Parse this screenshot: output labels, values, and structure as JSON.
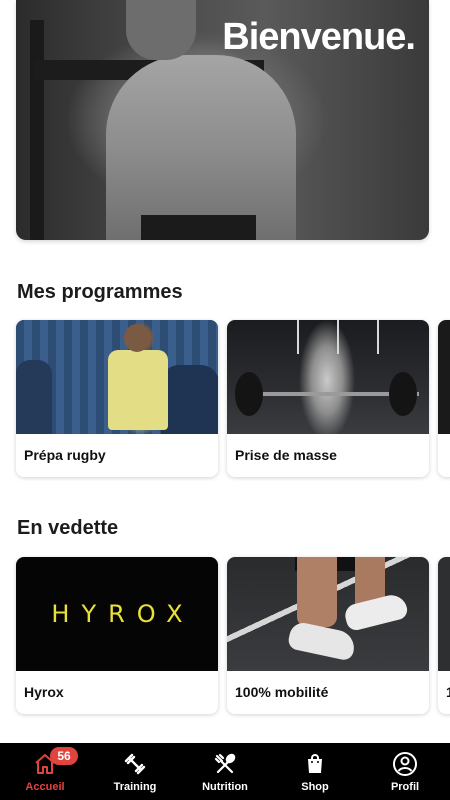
{
  "hero": {
    "title": "Bienvenue."
  },
  "sections": [
    {
      "title": "Mes programmes",
      "cards": [
        {
          "label": "Prépa rugby",
          "image": "rugby-player-photo"
        },
        {
          "label": "Prise de masse",
          "image": "deadlift-gym-photo"
        },
        {
          "label": "",
          "image": "partial-card"
        }
      ]
    },
    {
      "title": "En vedette",
      "cards": [
        {
          "label": "Hyrox",
          "image": "hyrox-logo",
          "brand_text": "HYROX"
        },
        {
          "label": "100% mobilité",
          "image": "sneakers-legs-photo"
        },
        {
          "label": "1",
          "image": "partial-card"
        }
      ]
    }
  ],
  "tabbar": {
    "items": [
      {
        "label": "Accueil",
        "icon": "home-icon",
        "active": true,
        "badge": "56"
      },
      {
        "label": "Training",
        "icon": "dumbbell-icon"
      },
      {
        "label": "Nutrition",
        "icon": "cutlery-icon"
      },
      {
        "label": "Shop",
        "icon": "shopping-bag-icon"
      },
      {
        "label": "Profil",
        "icon": "user-circle-icon"
      }
    ]
  },
  "colors": {
    "accent": "#e0443e",
    "hyrox_yellow": "#e9e039",
    "tabbar_bg": "#000000"
  }
}
